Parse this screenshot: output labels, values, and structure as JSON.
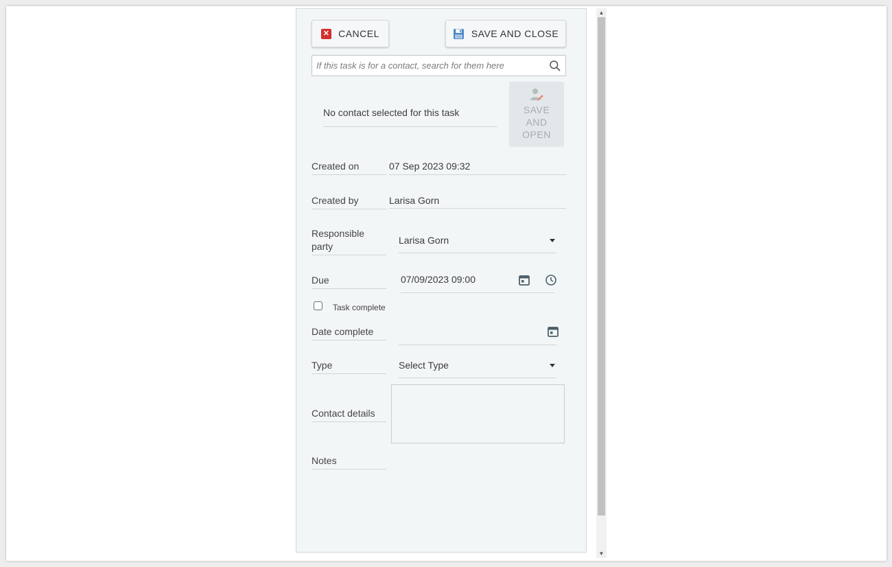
{
  "toolbar": {
    "cancel_label": "CANCEL",
    "save_close_label": "SAVE AND CLOSE"
  },
  "search": {
    "placeholder": "If this task is for a contact, search for them here"
  },
  "contact": {
    "none_text": "No contact selected for this task",
    "save_open_line1": "SAVE",
    "save_open_line2": "AND",
    "save_open_line3": "OPEN"
  },
  "form": {
    "created_on_label": "Created on",
    "created_on_value": "07 Sep 2023 09:32",
    "created_by_label": "Created by",
    "created_by_value": "Larisa Gorn",
    "responsible_label": "Responsible party",
    "responsible_value": "Larisa Gorn",
    "due_label": "Due",
    "due_value": "07/09/2023 09:00",
    "task_complete_label": "Task complete",
    "date_complete_label": "Date complete",
    "date_complete_value": "",
    "type_label": "Type",
    "type_value": "Select Type",
    "contact_details_label": "Contact details",
    "notes_label": "Notes"
  },
  "colors": {
    "cancel_icon": "#d32f2f",
    "save_icon": "#4a86c5",
    "panel_bg": "#f2f6f7"
  },
  "icons": {
    "cancel": "close-square-icon",
    "save": "floppy-disk-icon",
    "search": "search-icon",
    "save_open": "person-edit-icon",
    "calendar": "calendar-icon",
    "clock": "clock-icon",
    "dropdown": "caret-down-icon"
  }
}
